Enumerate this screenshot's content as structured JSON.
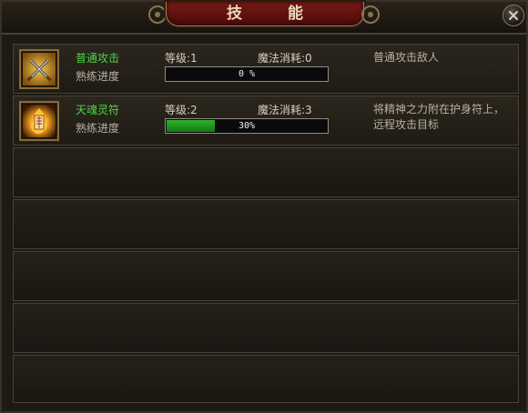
{
  "window": {
    "title": "技 能"
  },
  "colors": {
    "skill_name": "#4fd44a",
    "progress_fill": "#2fb32a",
    "title_plate": "#7a1a18"
  },
  "skills": [
    {
      "icon": "crossed-swords-icon",
      "name": "普通攻击",
      "progress_label": "熟练进度",
      "level": "等级:1",
      "mana": "魔法消耗:0",
      "progress_text": "0 %",
      "progress_value": 0,
      "description": "普通攻击敌人"
    },
    {
      "icon": "flaming-talisman-icon",
      "name": "天魂灵符",
      "progress_label": "熟练进度",
      "level": "等级:2",
      "mana": "魔法消耗:3",
      "progress_text": "30%",
      "progress_value": 0.3,
      "description": "将精神之力附在护身符上，远程攻击目标"
    }
  ]
}
